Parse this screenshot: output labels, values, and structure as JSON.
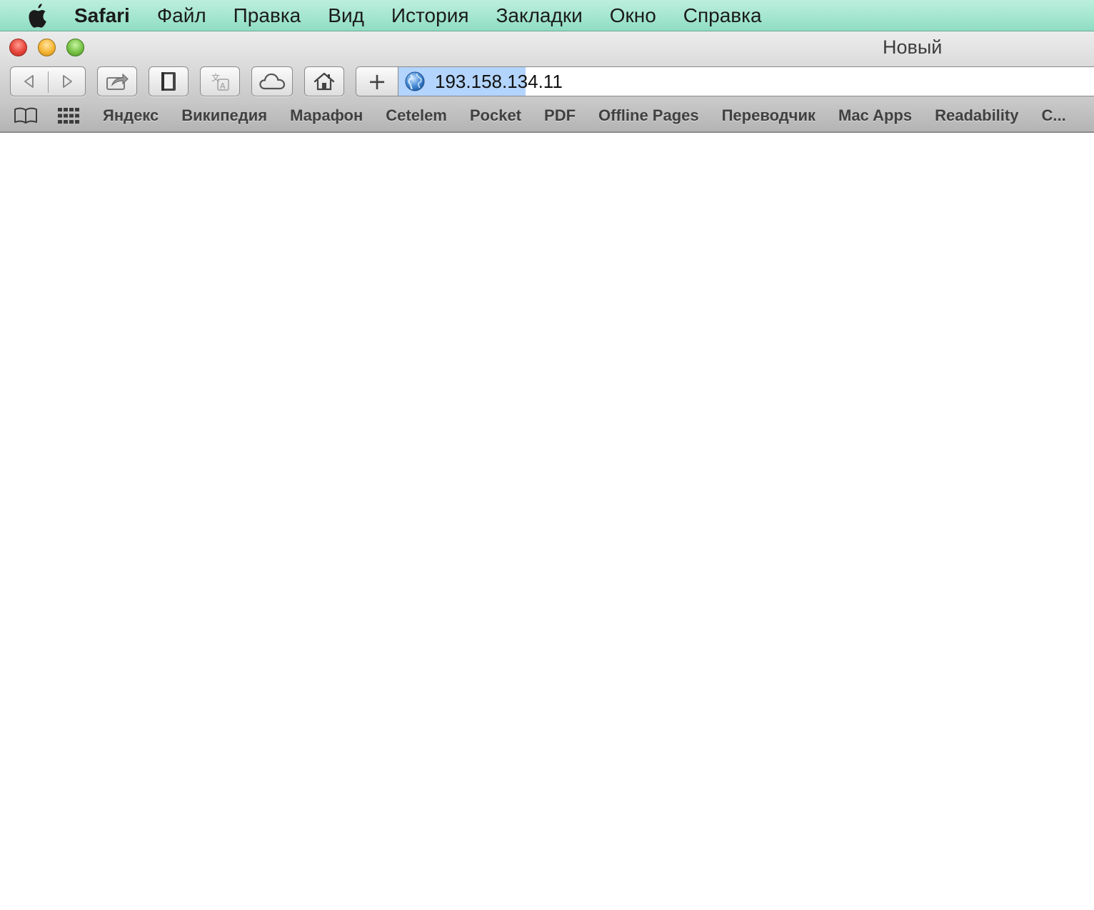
{
  "menubar": {
    "app_name": "Safari",
    "items": [
      "Файл",
      "Правка",
      "Вид",
      "История",
      "Закладки",
      "Окно",
      "Справка"
    ]
  },
  "window": {
    "title": "Новый"
  },
  "toolbar": {
    "add_label": "+",
    "address": {
      "value": "193.158.134.11",
      "selection_color": "#b3d4fc"
    }
  },
  "bookmarks": {
    "items": [
      "Яндекс",
      "Википедия",
      "Марафон",
      "Cetelem",
      "Pocket",
      "PDF",
      "Offline Pages",
      "Переводчик",
      "Mac Apps",
      "Readability",
      "C..."
    ]
  },
  "colors": {
    "menubar": "#a4e6cf",
    "close": "#e8453a",
    "minimize": "#f5b533",
    "zoom": "#77c245"
  },
  "icons": {
    "apple": "apple-icon",
    "back": "chevron-left-icon",
    "forward": "chevron-right-icon",
    "share": "share-icon",
    "reader": "reader-icon",
    "translate": "translate-icon",
    "cloud": "cloud-icon",
    "home": "home-icon",
    "globe": "globe-icon",
    "reading_list": "book-icon",
    "top_sites": "grid-icon"
  }
}
